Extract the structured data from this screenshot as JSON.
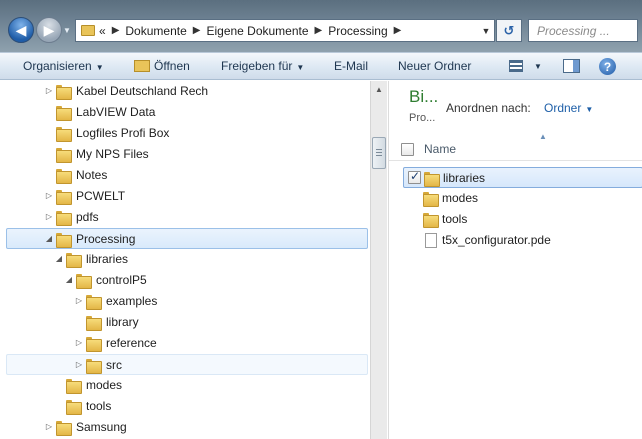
{
  "address": {
    "path": [
      "Dokumente",
      "Eigene Dokumente",
      "Processing"
    ],
    "overflow_glyph": "«",
    "search_placeholder": "Processing ..."
  },
  "toolbar": {
    "organize": "Organisieren",
    "open": "Öffnen",
    "share": "Freigeben für",
    "email": "E-Mail",
    "new_folder": "Neuer Ordner"
  },
  "tree": [
    {
      "label": "Kabel Deutschland Rech",
      "expander": "collapsed"
    },
    {
      "label": "LabVIEW Data",
      "expander": "none"
    },
    {
      "label": "Logfiles Profi Box",
      "expander": "none"
    },
    {
      "label": "My NPS Files",
      "expander": "none"
    },
    {
      "label": "Notes",
      "expander": "none"
    },
    {
      "label": "PCWELT",
      "expander": "collapsed"
    },
    {
      "label": "pdfs",
      "expander": "collapsed"
    },
    {
      "label": "Processing",
      "expander": "expanded",
      "state": "selected"
    },
    {
      "label": "libraries",
      "expander": "expanded"
    },
    {
      "label": "controlP5",
      "expander": "expanded"
    },
    {
      "label": "examples",
      "expander": "collapsed"
    },
    {
      "label": "library",
      "expander": "none"
    },
    {
      "label": "reference",
      "expander": "collapsed"
    },
    {
      "label": "src",
      "expander": "collapsed",
      "state": "hover"
    },
    {
      "label": "modes",
      "expander": "none"
    },
    {
      "label": "tools",
      "expander": "none"
    },
    {
      "label": "Samsung",
      "expander": "collapsed"
    }
  ],
  "content": {
    "library_title": "Bi...",
    "library_subtitle": "Pro...",
    "arrange_label": "Anordnen nach:",
    "arrange_value": "Ordner",
    "column_name": "Name",
    "items": [
      {
        "name": "libraries",
        "type": "folder",
        "checked": true
      },
      {
        "name": "modes",
        "type": "folder",
        "checked": false
      },
      {
        "name": "tools",
        "type": "folder",
        "checked": false
      },
      {
        "name": "t5x_configurator.pde",
        "type": "file",
        "checked": false
      }
    ]
  },
  "colors": {
    "accent": "#1e5fa8",
    "library_title": "#2f7d31",
    "selection_border": "#9bc0e8"
  }
}
